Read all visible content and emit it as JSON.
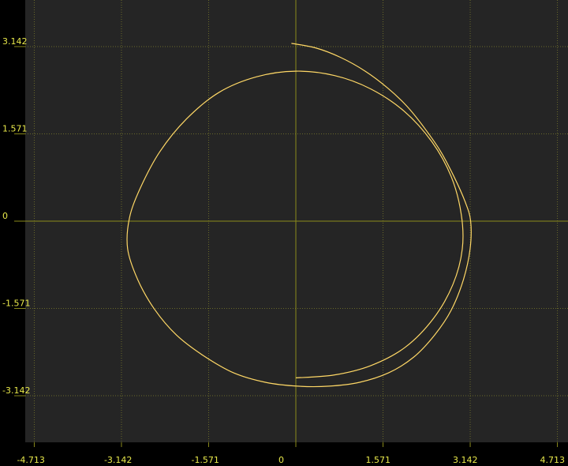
{
  "colors": {
    "background": "#000000",
    "plot_area": "#252525",
    "grid": "#6a6a2a",
    "axis": "#8a8a1a",
    "tick_text": "#e8e84a",
    "curve": "#ffd866"
  },
  "chart_data": {
    "type": "line",
    "title": "",
    "xlabel": "",
    "ylabel": "",
    "grid": true,
    "grid_style": "dotted",
    "xlim": [
      -4.713,
      4.713
    ],
    "ylim": [
      -4.0,
      4.0
    ],
    "x_ticks": [
      {
        "value": -4.713,
        "label": "-4.713"
      },
      {
        "value": -3.142,
        "label": "-3.142"
      },
      {
        "value": -1.571,
        "label": "-1.571"
      },
      {
        "value": 0,
        "label": "0"
      },
      {
        "value": 1.571,
        "label": "1.571"
      },
      {
        "value": 3.142,
        "label": "3.142"
      },
      {
        "value": 4.713,
        "label": "4.713"
      }
    ],
    "y_ticks": [
      {
        "value": 3.142,
        "label": "3.142"
      },
      {
        "value": 1.571,
        "label": "1.571"
      },
      {
        "value": 0,
        "label": "0"
      },
      {
        "value": -1.571,
        "label": "-1.571"
      },
      {
        "value": -3.142,
        "label": "-3.142"
      }
    ],
    "series": [
      {
        "color": "#ffd866",
        "x": [
          -0.08,
          0.35,
          0.8,
          1.25,
          1.65,
          2.0,
          2.3,
          2.6,
          2.85,
          3.05,
          3.15,
          3.14,
          3.02,
          2.8,
          2.5,
          2.12,
          1.67,
          1.15,
          0.6,
          0.03,
          -0.55,
          -1.12,
          -1.65,
          -2.15,
          -2.55,
          -2.85,
          -3.03,
          -3.0,
          -2.8,
          -2.45,
          -1.97,
          -1.38,
          -0.7,
          0.0,
          0.7,
          1.35,
          1.95,
          2.45,
          2.8,
          2.98,
          3.0,
          2.83,
          2.48,
          1.97,
          1.35,
          0.68,
          0.0
        ],
        "y": [
          3.2,
          3.12,
          2.95,
          2.7,
          2.4,
          2.07,
          1.7,
          1.27,
          0.8,
          0.35,
          0.0,
          -0.5,
          -1.05,
          -1.6,
          -2.05,
          -2.45,
          -2.73,
          -2.9,
          -2.97,
          -2.97,
          -2.9,
          -2.73,
          -2.43,
          -2.05,
          -1.58,
          -1.05,
          -0.5,
          0.05,
          0.6,
          1.25,
          1.84,
          2.32,
          2.6,
          2.7,
          2.62,
          2.38,
          1.98,
          1.43,
          0.8,
          0.13,
          -0.5,
          -1.14,
          -1.75,
          -2.27,
          -2.6,
          -2.77,
          -2.82
        ]
      }
    ]
  }
}
